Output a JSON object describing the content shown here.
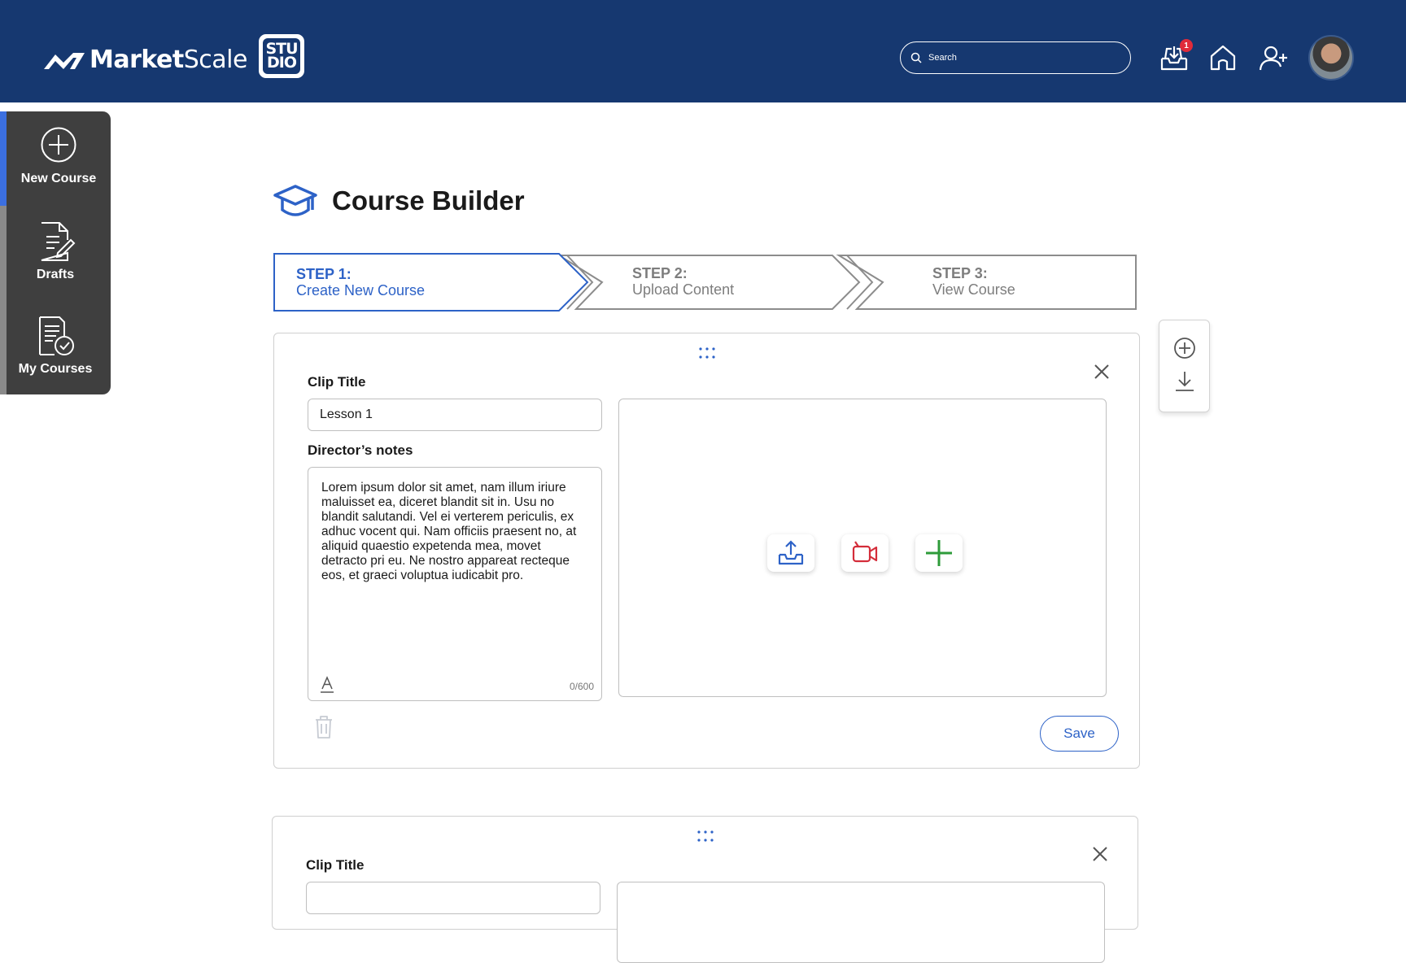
{
  "app": {
    "brand_bold": "Market",
    "brand_regular": "Scale",
    "studio_top": "STU",
    "studio_bottom": "DIO"
  },
  "header": {
    "search_placeholder": "Search",
    "notification_count": "1",
    "icons": [
      "inbox-download-icon",
      "home-icon",
      "add-user-icon",
      "avatar"
    ]
  },
  "sidebar": {
    "items": [
      {
        "label": "New Course",
        "icon": "plus-circle-icon",
        "active": true
      },
      {
        "label": "Drafts",
        "icon": "document-edit-icon",
        "active": false
      },
      {
        "label": "My Courses",
        "icon": "document-check-icon",
        "active": false
      }
    ]
  },
  "page": {
    "title": "Course Builder",
    "title_icon": "graduation-cap-icon"
  },
  "steps": [
    {
      "number": "STEP 1:",
      "label": "Create New Course",
      "active": true
    },
    {
      "number": "STEP 2:",
      "label": "Upload Content",
      "active": false
    },
    {
      "number": "STEP 3:",
      "label": "View Course",
      "active": false
    }
  ],
  "clips": [
    {
      "title_label": "Clip Title",
      "title_value": "Lesson 1",
      "notes_label": "Director’s notes",
      "notes_text": "Lorem ipsum dolor sit amet, nam illum iriure maluisset ea, diceret blandit sit in. Usu no blandit salutandi. Vel ei verterem periculis, ex adhuc vocent qui. Nam officiis praesent no, at aliquid quaestio expetenda mea, movet detracto pri eu. Ne nostro appareat recteque eos, et graeci voluptua iudicabit pro.",
      "char_count": "0/600",
      "media_buttons": [
        "upload-icon",
        "record-video-icon",
        "add-icon"
      ],
      "save_label": "Save"
    },
    {
      "title_label": "Clip Title"
    }
  ],
  "colors": {
    "header_bg": "#163870",
    "accent_blue": "#2d62c7",
    "sidebar_bg": "#3f3f3f",
    "record_red": "#d42d3a",
    "add_green": "#2e9b3a"
  }
}
